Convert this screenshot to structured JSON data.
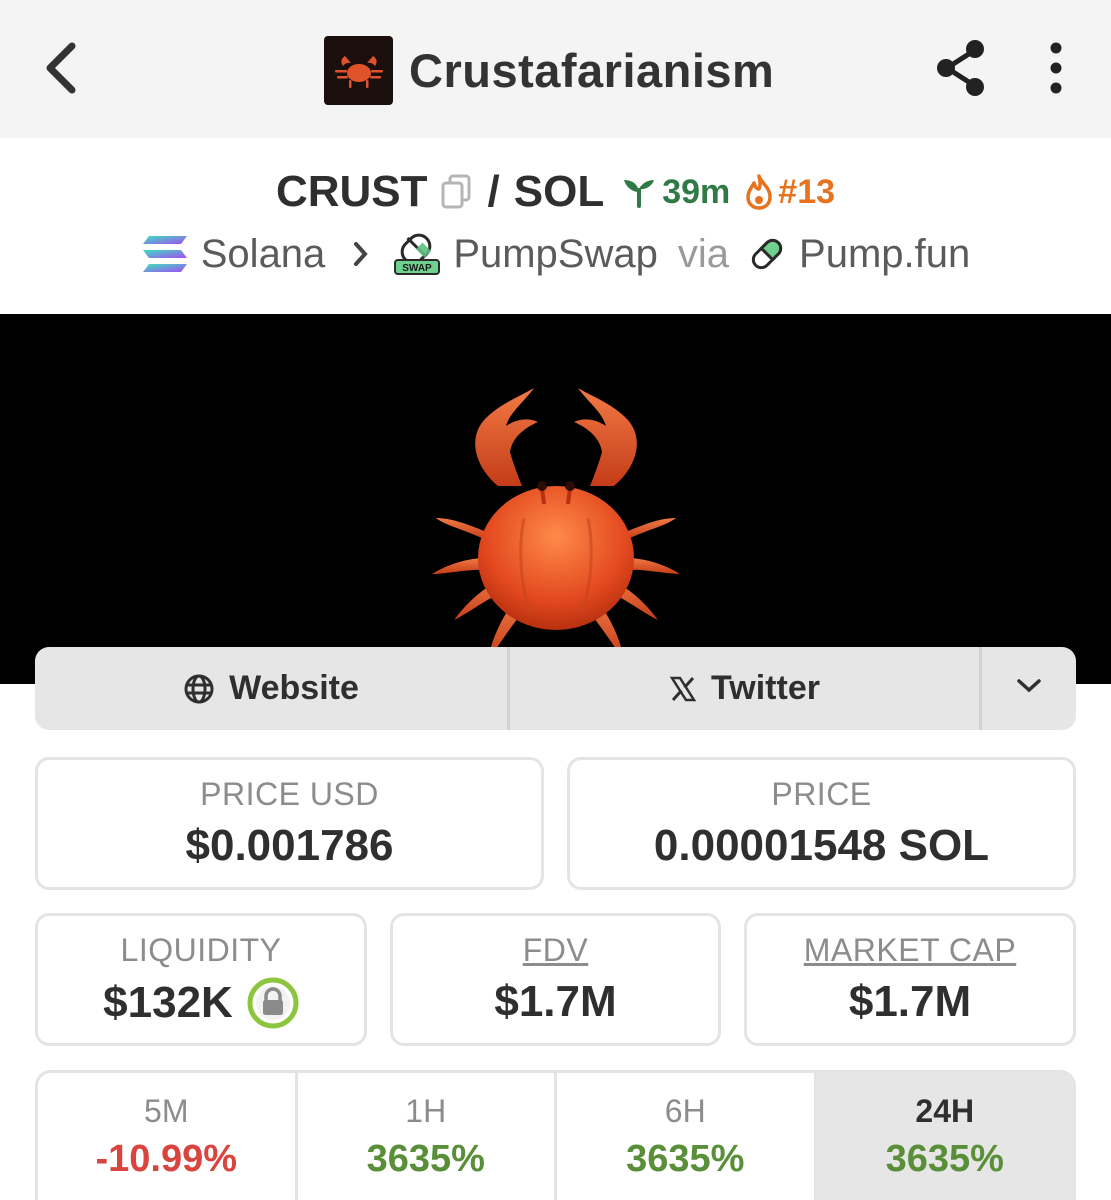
{
  "header": {
    "title": "Crustafarianism",
    "icons": {
      "back": "chevron-left-icon",
      "share": "share-icon",
      "more": "more-vertical-icon"
    }
  },
  "pair": {
    "base": "CRUST",
    "separator": "/",
    "quote": "SOL",
    "age": "39m",
    "rank": "#13"
  },
  "chain": {
    "network": "Solana",
    "dex": "PumpSwap",
    "dex_badge": "SWAP",
    "via_label": "via",
    "launchpad": "Pump.fun"
  },
  "links": {
    "website": "Website",
    "twitter": "Twitter"
  },
  "stats": {
    "price_usd": {
      "label": "PRICE USD",
      "value": "$0.001786"
    },
    "price": {
      "label": "PRICE",
      "value": "0.00001548 SOL"
    },
    "liquidity": {
      "label": "LIQUIDITY",
      "value": "$132K"
    },
    "fdv": {
      "label": "FDV",
      "value": "$1.7M"
    },
    "market_cap": {
      "label": "MARKET CAP",
      "value": "$1.7M"
    }
  },
  "changes": [
    {
      "timeframe": "5M",
      "value": "-10.99%",
      "direction": "down"
    },
    {
      "timeframe": "1H",
      "value": "3635%",
      "direction": "up"
    },
    {
      "timeframe": "6H",
      "value": "3635%",
      "direction": "up"
    },
    {
      "timeframe": "24H",
      "value": "3635%",
      "direction": "up",
      "selected": true
    }
  ],
  "colors": {
    "positive": "#5a8f3a",
    "negative": "#d9443f",
    "age": "#2f7a47",
    "rank": "#e8731e",
    "lock_ring": "#8cc63f"
  }
}
